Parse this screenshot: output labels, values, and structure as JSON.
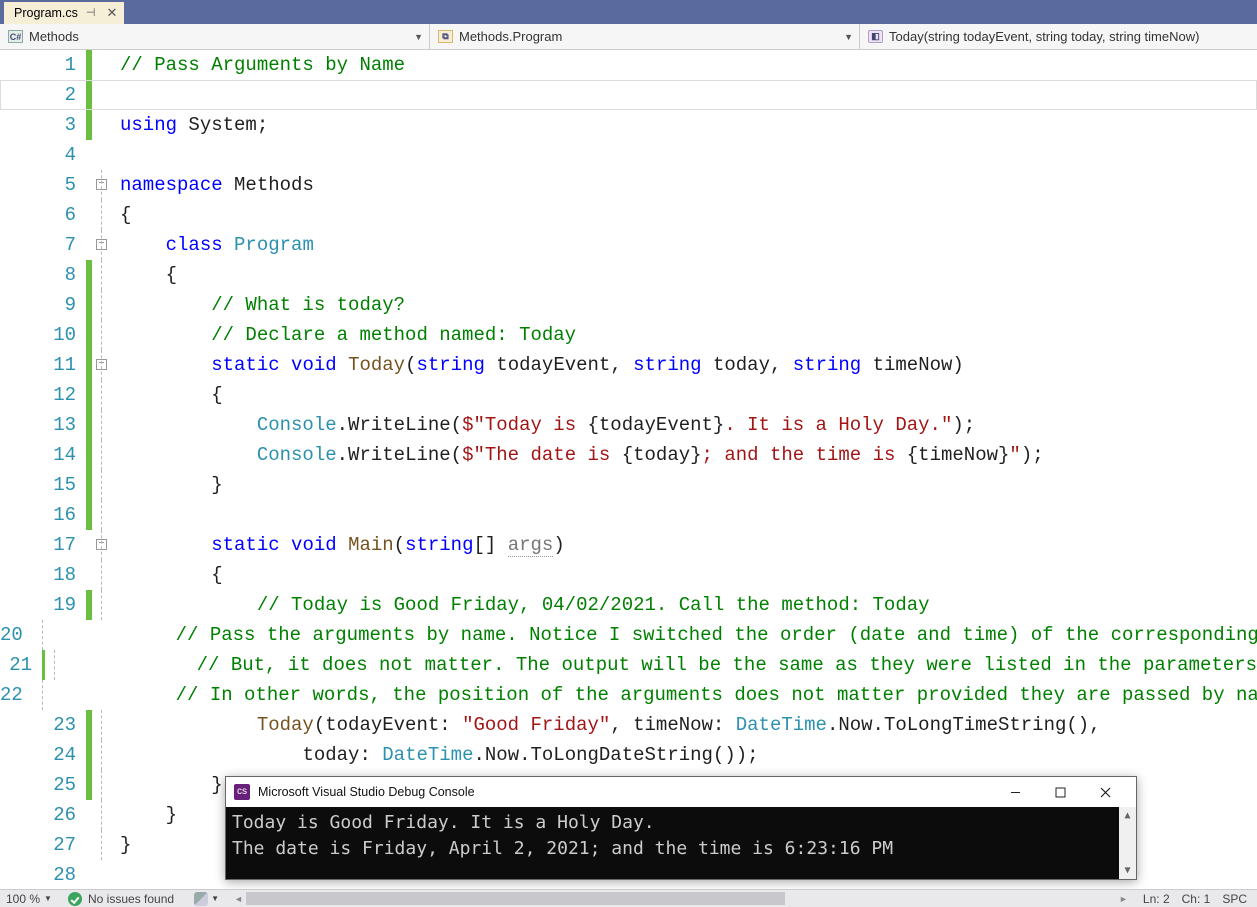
{
  "tab": {
    "filename": "Program.cs"
  },
  "nav": {
    "scope": "Methods",
    "type": "Methods.Program",
    "member": "Today(string todayEvent, string today, string timeNow)"
  },
  "code": {
    "lines": [
      {
        "n": 1,
        "mod": true,
        "fold": "",
        "html": "<span class='c-com'>// Pass Arguments by Name</span>"
      },
      {
        "n": 2,
        "mod": true,
        "fold": "",
        "current": true,
        "html": ""
      },
      {
        "n": 3,
        "mod": true,
        "fold": "",
        "html": "<span class='c-kw'>using</span><span class='c-txt'> System;</span>"
      },
      {
        "n": 4,
        "mod": false,
        "fold": "",
        "html": ""
      },
      {
        "n": 5,
        "mod": false,
        "fold": "minus",
        "html": "<span class='c-kw'>namespace</span><span class='c-txt'> Methods</span>"
      },
      {
        "n": 6,
        "mod": false,
        "fold": "line",
        "html": "<span class='c-txt'>{</span>"
      },
      {
        "n": 7,
        "mod": false,
        "fold": "minus",
        "html": "    <span class='c-kw'>class</span> <span class='c-type'>Program</span>"
      },
      {
        "n": 8,
        "mod": true,
        "fold": "line",
        "html": "    <span class='c-txt'>{</span>"
      },
      {
        "n": 9,
        "mod": true,
        "fold": "line",
        "html": "        <span class='c-com'>// What is today?</span>"
      },
      {
        "n": 10,
        "mod": true,
        "fold": "line",
        "html": "        <span class='c-com'>// Declare a method named: Today</span>"
      },
      {
        "n": 11,
        "mod": true,
        "fold": "minus",
        "html": "        <span class='c-kw'>static</span> <span class='c-kw'>void</span> <span class='c-meth'>Today</span><span class='c-txt'>(</span><span class='c-kw'>string</span><span class='c-txt'> todayEvent, </span><span class='c-kw'>string</span><span class='c-txt'> today, </span><span class='c-kw'>string</span><span class='c-txt'> timeNow)</span>"
      },
      {
        "n": 12,
        "mod": true,
        "fold": "line",
        "html": "        <span class='c-txt'>{</span>"
      },
      {
        "n": 13,
        "mod": true,
        "fold": "line",
        "html": "            <span class='c-type'>Console</span><span class='c-txt'>.WriteLine(</span><span class='c-str'>$\"Today is </span><span class='c-txt'>{todayEvent}</span><span class='c-str'>. It is a Holy Day.\"</span><span class='c-txt'>);</span>"
      },
      {
        "n": 14,
        "mod": true,
        "fold": "line",
        "html": "            <span class='c-type'>Console</span><span class='c-txt'>.WriteLine(</span><span class='c-str'>$\"The date is </span><span class='c-txt'>{today}</span><span class='c-str'>; and the time is </span><span class='c-txt'>{timeNow}</span><span class='c-str'>\"</span><span class='c-txt'>);</span>"
      },
      {
        "n": 15,
        "mod": true,
        "fold": "line",
        "html": "        <span class='c-txt'>}</span>"
      },
      {
        "n": 16,
        "mod": true,
        "fold": "line",
        "html": ""
      },
      {
        "n": 17,
        "mod": false,
        "fold": "minus",
        "html": "        <span class='c-kw'>static</span> <span class='c-kw'>void</span> <span class='c-meth'>Main</span><span class='c-txt'>(</span><span class='c-kw'>string</span><span class='c-txt'>[] </span><span class='c-mut'>args</span><span class='c-txt'>)</span>"
      },
      {
        "n": 18,
        "mod": false,
        "fold": "line",
        "html": "        <span class='c-txt'>{</span>"
      },
      {
        "n": 19,
        "mod": true,
        "fold": "line",
        "html": "            <span class='c-com'>// Today is Good Friday, 04/02/2021. Call the method: Today</span>"
      },
      {
        "n": 20,
        "mod": true,
        "fold": "line",
        "html": "            <span class='c-com'>// Pass the arguments by name. Notice I switched the order (date and time) of the corresponding parameters</span>"
      },
      {
        "n": 21,
        "mod": true,
        "fold": "line",
        "html": "            <span class='c-com'>// But, it does not matter. The output will be the same as they were listed in the parameters</span>"
      },
      {
        "n": 22,
        "mod": true,
        "fold": "line",
        "html": "            <span class='c-com'>// In other words, the position of the arguments does not matter provided they are passed by name</span>"
      },
      {
        "n": 23,
        "mod": true,
        "fold": "line",
        "html": "            <span class='c-meth'>Today</span><span class='c-txt'>(todayEvent: </span><span class='c-str'>\"Good Friday\"</span><span class='c-txt'>, timeNow: </span><span class='c-type'>DateTime</span><span class='c-txt'>.Now.ToLongTimeString(),</span>"
      },
      {
        "n": 24,
        "mod": true,
        "fold": "line",
        "html": "                <span class='c-txt'>today: </span><span class='c-type'>DateTime</span><span class='c-txt'>.Now.ToLongDateString());</span>"
      },
      {
        "n": 25,
        "mod": true,
        "fold": "line",
        "html": "        <span class='c-txt'>}</span>"
      },
      {
        "n": 26,
        "mod": false,
        "fold": "line",
        "html": "    <span class='c-txt'>}</span>"
      },
      {
        "n": 27,
        "mod": false,
        "fold": "line",
        "html": "<span class='c-txt'>}</span>"
      },
      {
        "n": 28,
        "mod": false,
        "fold": "",
        "html": ""
      }
    ]
  },
  "console": {
    "title": "Microsoft Visual Studio Debug Console",
    "lines": [
      "Today is Good Friday. It is a Holy Day.",
      "The date is Friday, April 2, 2021; and the time is 6:23:16 PM"
    ]
  },
  "status": {
    "zoom": "100 %",
    "issues": "No issues found",
    "ln": "Ln: 2",
    "ch": "Ch: 1",
    "mode": "SPC"
  }
}
